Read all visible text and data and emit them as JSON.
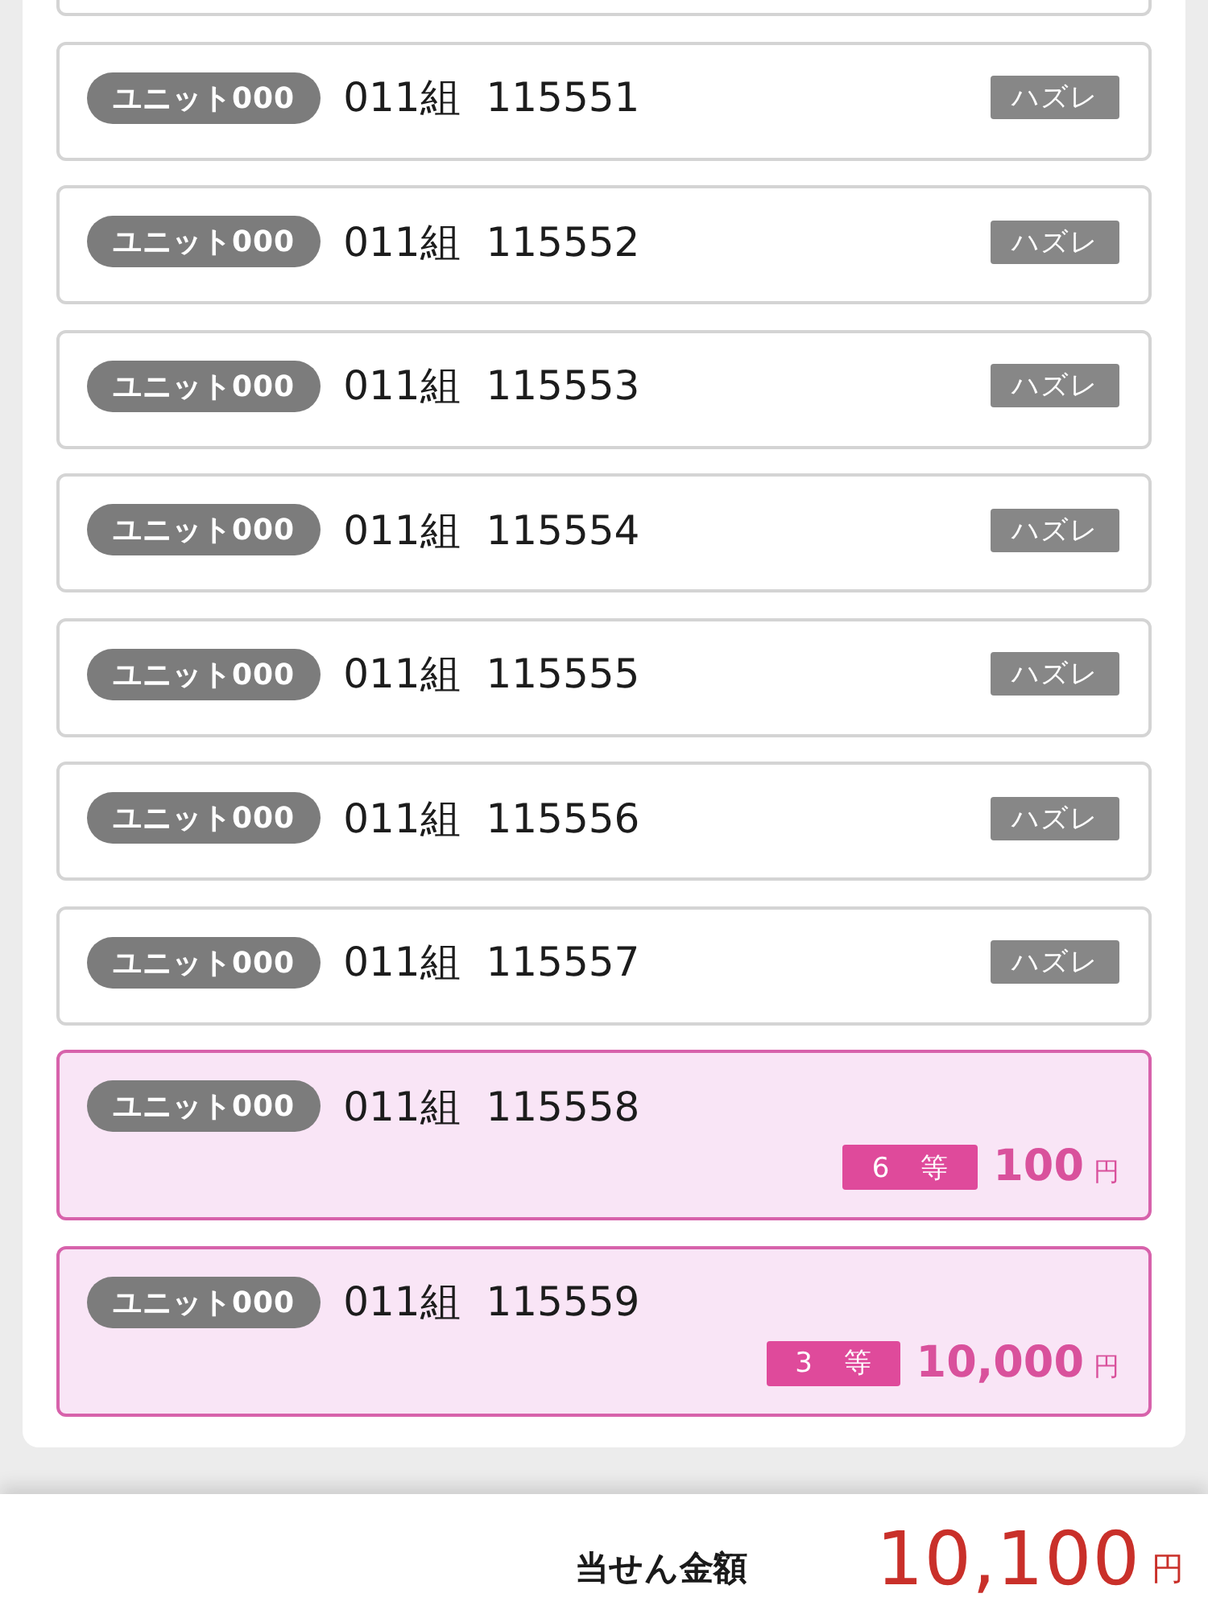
{
  "tickets": [
    {
      "kind": "miss",
      "unit": "ユニット000",
      "number": "011組 115551",
      "result": "ハズレ"
    },
    {
      "kind": "miss",
      "unit": "ユニット000",
      "number": "011組 115552",
      "result": "ハズレ"
    },
    {
      "kind": "miss",
      "unit": "ユニット000",
      "number": "011組 115553",
      "result": "ハズレ"
    },
    {
      "kind": "miss",
      "unit": "ユニット000",
      "number": "011組 115554",
      "result": "ハズレ"
    },
    {
      "kind": "miss",
      "unit": "ユニット000",
      "number": "011組 115555",
      "result": "ハズレ"
    },
    {
      "kind": "miss",
      "unit": "ユニット000",
      "number": "011組 115556",
      "result": "ハズレ"
    },
    {
      "kind": "miss",
      "unit": "ユニット000",
      "number": "011組 115557",
      "result": "ハズレ"
    },
    {
      "kind": "prize",
      "unit": "ユニット000",
      "number": "011組 115558",
      "rank": "6 等",
      "amount": "100",
      "currency": "円"
    },
    {
      "kind": "prize",
      "unit": "ユニット000",
      "number": "011組 115559",
      "rank": "3 等",
      "amount": "10,000",
      "currency": "円"
    }
  ],
  "total": {
    "label": "当せん金額",
    "amount": "10,100",
    "currency": "円"
  }
}
